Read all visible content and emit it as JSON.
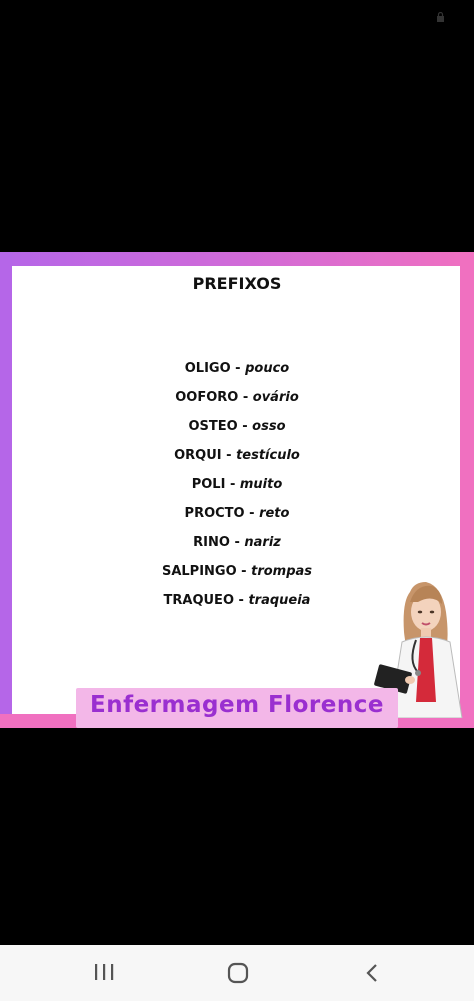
{
  "card": {
    "title": "PREFIXOS",
    "items": [
      {
        "prefix": "OLIGO",
        "sep": " - ",
        "meaning": "pouco"
      },
      {
        "prefix": "OOFORO",
        "sep": " - ",
        "meaning": "ovário"
      },
      {
        "prefix": "OSTEO",
        "sep": " - ",
        "meaning": "osso"
      },
      {
        "prefix": "ORQUI",
        "sep": " - ",
        "meaning": "testículo"
      },
      {
        "prefix": "POLI",
        "sep": " - ",
        "meaning": "muito"
      },
      {
        "prefix": "PROCTO",
        "sep": " - ",
        "meaning": "reto"
      },
      {
        "prefix": "RINO",
        "sep": " - ",
        "meaning": "nariz"
      },
      {
        "prefix": "SALPINGO",
        "sep": " - ",
        "meaning": "trompas"
      },
      {
        "prefix": "TRAQUEO",
        "sep": " - ",
        "meaning": "traqueia"
      }
    ],
    "brand": "Enfermagem Florence"
  },
  "colors": {
    "frame_purple": "#b566e8",
    "frame_pink": "#f070c0",
    "banner_bg": "#f3b7e8",
    "brand_text": "#9a2fd0"
  },
  "icons": {
    "status": "lock-icon",
    "nav_recents": "recents-icon",
    "nav_home": "home-icon",
    "nav_back": "back-icon"
  }
}
